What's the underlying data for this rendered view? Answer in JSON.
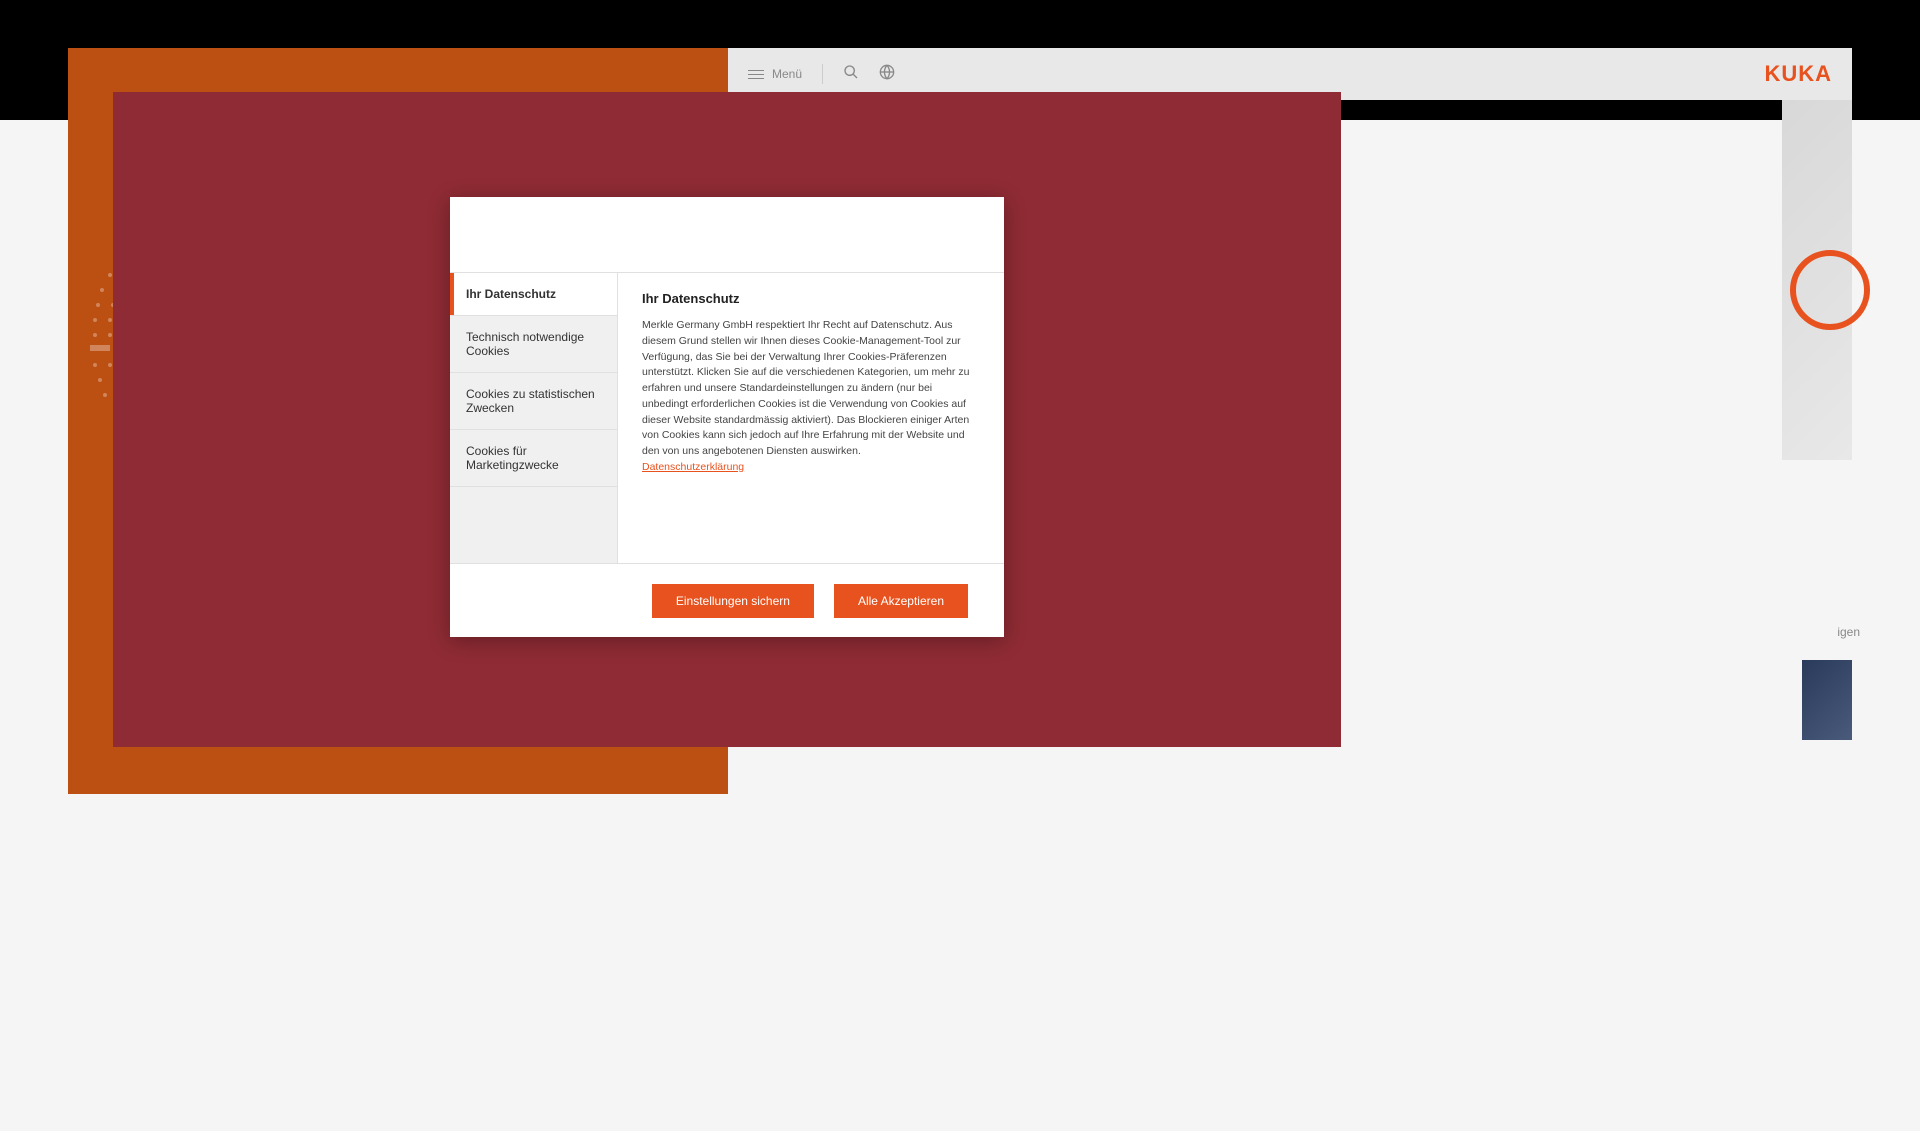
{
  "header": {
    "menu_label": "Menü",
    "logo_text": "KUKA"
  },
  "side": {
    "text_fragment": "igen"
  },
  "cookie_modal": {
    "tabs": [
      {
        "label": "Ihr Datenschutz",
        "active": true
      },
      {
        "label": "Technisch notwendige Cookies",
        "active": false
      },
      {
        "label": "Cookies zu statistischen Zwecken",
        "active": false
      },
      {
        "label": "Cookies für Marketingzwecke",
        "active": false
      }
    ],
    "content": {
      "title": "Ihr Datenschutz",
      "body": "Merkle Germany GmbH respektiert Ihr Recht auf Datenschutz. Aus diesem Grund stellen wir Ihnen dieses Cookie-Management-Tool zur Verfügung, das Sie bei der Verwaltung Ihrer Cookies-Präferenzen unterstützt. Klicken Sie auf die verschiedenen Kategorien, um mehr zu erfahren und unsere Standardeinstellungen zu ändern (nur bei unbedingt erforderlichen Cookies ist die Verwendung von Cookies auf dieser Website standardmässig aktiviert). Das Blockieren einiger Arten von Cookies kann sich jedoch auf Ihre Erfahrung mit der Website und den von uns angebotenen Diensten auswirken.",
      "privacy_link_label": "Datenschutzerklärung"
    },
    "buttons": {
      "save_label": "Einstellungen sichern",
      "accept_all_label": "Alle Akzeptieren"
    }
  }
}
